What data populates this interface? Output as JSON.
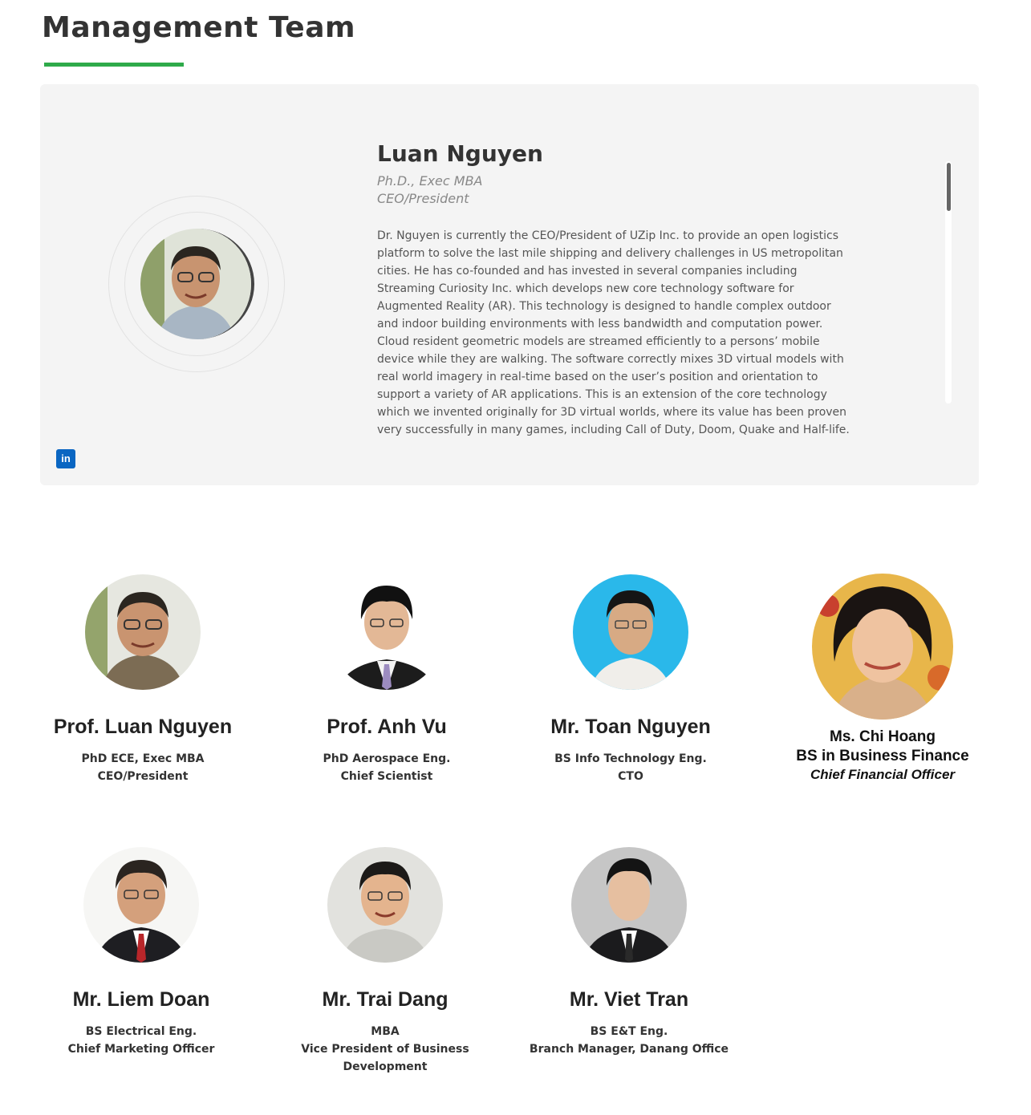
{
  "section": {
    "title": "Management Team"
  },
  "featured": {
    "name": "Luan Nguyen",
    "credentials": "Ph.D., Exec MBA",
    "role": "CEO/President",
    "bio": "Dr. Nguyen is currently the CEO/President of UZip Inc. to provide an open logistics platform to solve the last mile shipping and delivery challenges in US metropolitan cities. He has co-founded and has invested in several companies including Streaming Curiosity Inc. which develops new core technology software for Augmented Reality (AR). This technology is designed to handle complex outdoor and indoor building environments with less bandwidth and computation power. Cloud resident geometric models are streamed efficiently to a persons’ mobile device while they are walking. The software correctly mixes 3D virtual models with real world imagery in real-time based on the user’s position and orientation to support a variety of AR applications. This is an extension of the core technology which we invented originally for 3D virtual worlds, where its value has been proven very successfully in many games, including Call of Duty, Doom, Quake and Half-life.",
    "social_icon": "linkedin-icon",
    "social_label": "in"
  },
  "team": [
    {
      "name": "Prof. Luan Nguyen",
      "degree": "PhD ECE, Exec MBA",
      "role": "CEO/President"
    },
    {
      "name": "Prof. Anh Vu",
      "degree": "PhD Aerospace Eng.",
      "role": "Chief Scientist"
    },
    {
      "name": "Mr. Toan Nguyen",
      "degree": "BS Info Technology Eng.",
      "role": "CTO"
    },
    {
      "name": "Ms. Chi Hoang",
      "degree": "BS in Business Finance",
      "role": "Chief Financial Officer"
    },
    {
      "name": "Mr. Liem Doan",
      "degree": "BS Electrical Eng.",
      "role": "Chief Marketing Officer"
    },
    {
      "name": "Mr. Trai Dang",
      "degree": "MBA",
      "role": "Vice President of Business Development"
    },
    {
      "name": "Mr. Viet Tran",
      "degree": "BS E&T Eng.",
      "role": "Branch Manager, Danang Office"
    }
  ],
  "colors": {
    "accent": "#2eaa4a",
    "panel": "#f4f4f4",
    "linkedin": "#0a66c2"
  }
}
